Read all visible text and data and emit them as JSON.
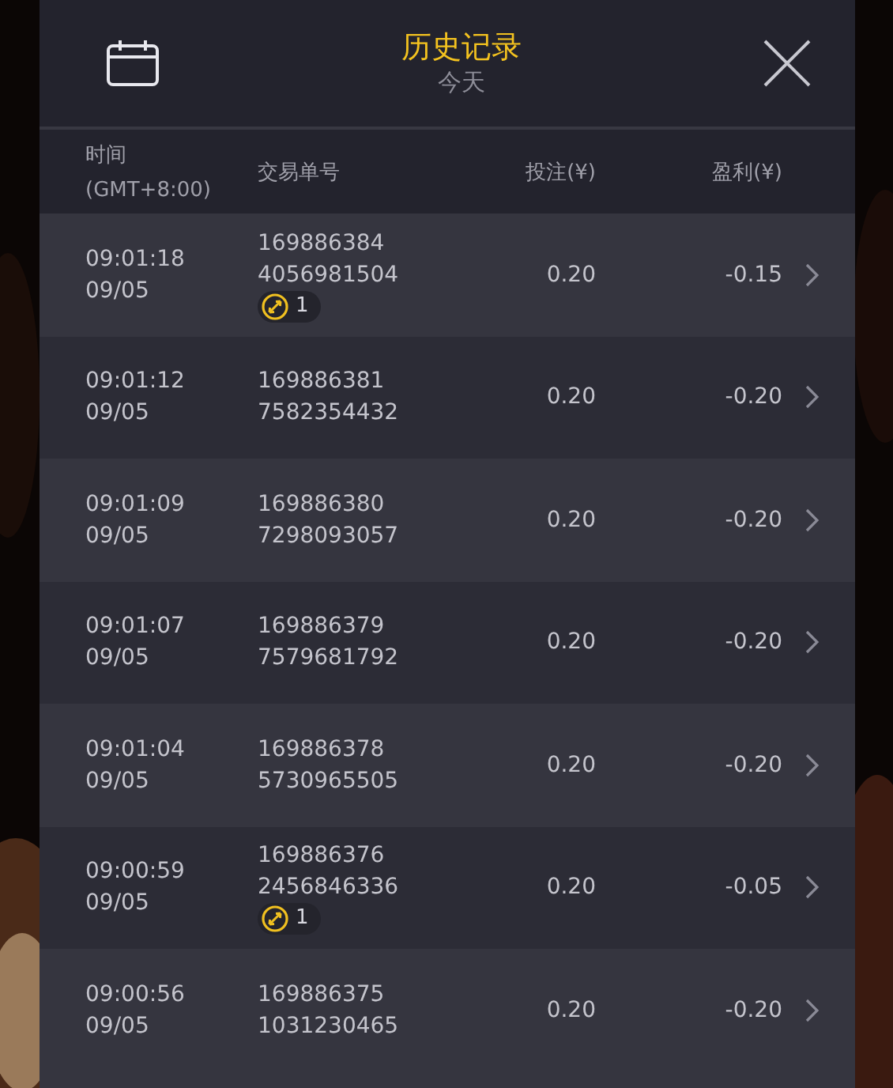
{
  "header": {
    "title": "历史记录",
    "subtitle": "今天"
  },
  "columns": [
    {
      "label": "时间",
      "sub": "(GMT+8:00)"
    },
    {
      "label": "交易单号"
    },
    {
      "label": "投注(¥)"
    },
    {
      "label": "盈利(¥)"
    }
  ],
  "rows": [
    {
      "time": "09:01:18",
      "date": "09/05",
      "order": [
        "169886384",
        "4056981504"
      ],
      "badge": "1",
      "bet": "0.20",
      "profit": "-0.15"
    },
    {
      "time": "09:01:12",
      "date": "09/05",
      "order": [
        "169886381",
        "7582354432"
      ],
      "bet": "0.20",
      "profit": "-0.20"
    },
    {
      "time": "09:01:09",
      "date": "09/05",
      "order": [
        "169886380",
        "7298093057"
      ],
      "bet": "0.20",
      "profit": "-0.20"
    },
    {
      "time": "09:01:07",
      "date": "09/05",
      "order": [
        "169886379",
        "7579681792"
      ],
      "bet": "0.20",
      "profit": "-0.20"
    },
    {
      "time": "09:01:04",
      "date": "09/05",
      "order": [
        "169886378",
        "5730965505"
      ],
      "bet": "0.20",
      "profit": "-0.20"
    },
    {
      "time": "09:00:59",
      "date": "09/05",
      "order": [
        "169886376",
        "2456846336"
      ],
      "badge": "1",
      "bet": "0.20",
      "profit": "-0.05"
    },
    {
      "time": "09:00:56",
      "date": "09/05",
      "order": [
        "169886375",
        "1031230465"
      ],
      "bet": "0.20",
      "profit": "-0.20"
    }
  ]
}
